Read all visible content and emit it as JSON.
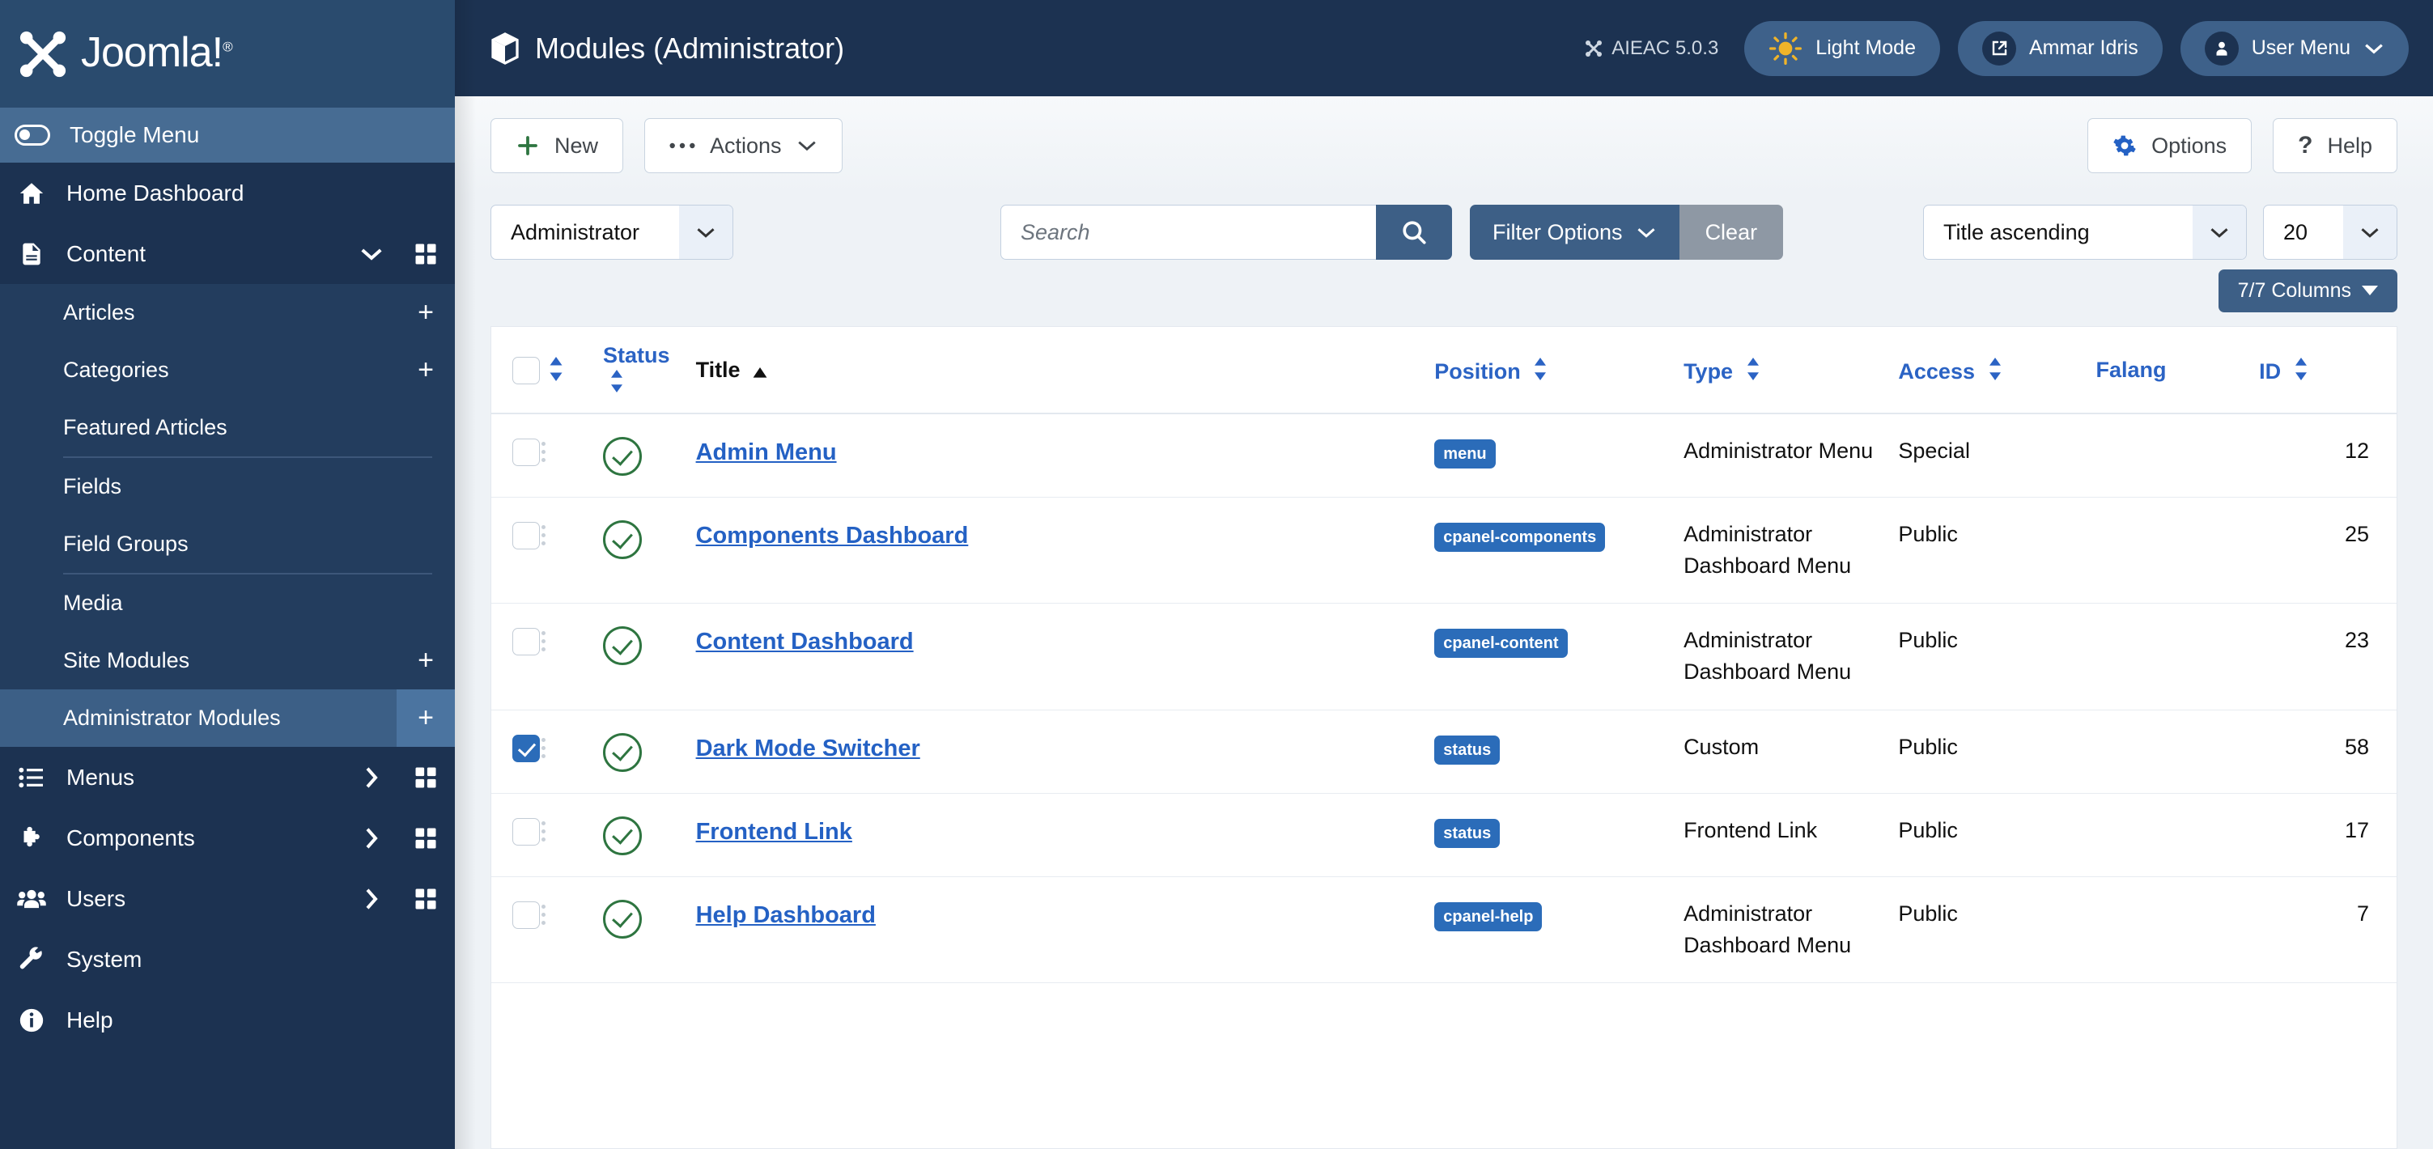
{
  "brand": {
    "name": "Joomla!",
    "trademark": "®"
  },
  "topbar": {
    "page_title": "Modules (Administrator)",
    "version": "AIEAC 5.0.3",
    "light_mode": "Light Mode",
    "site_link": "Ammar Idris",
    "user_menu": "User Menu"
  },
  "sidebar": {
    "toggle": "Toggle Menu",
    "items": [
      {
        "label": "Home Dashboard",
        "icon": "home-icon",
        "caret": "",
        "grid": false
      },
      {
        "label": "Content",
        "icon": "document-icon",
        "caret": "∨",
        "grid": true
      },
      {
        "label": "Menus",
        "icon": "list-icon",
        "caret": "›",
        "grid": true
      },
      {
        "label": "Components",
        "icon": "puzzle-icon",
        "caret": "›",
        "grid": true
      },
      {
        "label": "Users",
        "icon": "users-icon",
        "caret": "›",
        "grid": true
      },
      {
        "label": "System",
        "icon": "wrench-icon",
        "caret": "",
        "grid": false
      },
      {
        "label": "Help",
        "icon": "info-icon",
        "caret": "",
        "grid": false
      }
    ],
    "content_submenu": [
      {
        "label": "Articles",
        "plus": "+"
      },
      {
        "label": "Categories",
        "plus": "+"
      },
      {
        "label": "Featured Articles",
        "plus": ""
      },
      {
        "label": "Fields",
        "plus": ""
      },
      {
        "label": "Field Groups",
        "plus": ""
      },
      {
        "label": "Media",
        "plus": ""
      },
      {
        "label": "Site Modules",
        "plus": "+"
      },
      {
        "label": "Administrator Modules",
        "plus": "+",
        "active": true
      }
    ]
  },
  "toolbar": {
    "new_label": "New",
    "actions_label": "Actions",
    "options_label": "Options",
    "help_label": "Help"
  },
  "filterbar": {
    "client_select": "Administrator",
    "search_placeholder": "Search",
    "search_value": "",
    "filter_options": "Filter Options",
    "clear": "Clear",
    "ordering": "Title ascending",
    "limit": "20",
    "columns_button": "7/7 Columns"
  },
  "table": {
    "headers": {
      "ordering": "",
      "status": "Status",
      "title": "Title",
      "position": "Position",
      "type": "Type",
      "access": "Access",
      "falang": "Falang",
      "id": "ID"
    },
    "active_sort_column": "Title",
    "active_sort_direction": "ascending",
    "rows": [
      {
        "checked": false,
        "status": "published",
        "title": "Admin Menu",
        "position": "menu",
        "type": "Administrator Menu",
        "access": "Special",
        "falang": "",
        "id": "12"
      },
      {
        "checked": false,
        "status": "published",
        "title": "Components Dashboard",
        "position": "cpanel-components",
        "type": "Administrator Dashboard Menu",
        "access": "Public",
        "falang": "",
        "id": "25"
      },
      {
        "checked": false,
        "status": "published",
        "title": "Content Dashboard",
        "position": "cpanel-content",
        "type": "Administrator Dashboard Menu",
        "access": "Public",
        "falang": "",
        "id": "23"
      },
      {
        "checked": true,
        "status": "published",
        "title": "Dark Mode Switcher",
        "position": "status",
        "type": "Custom",
        "access": "Public",
        "falang": "",
        "id": "58"
      },
      {
        "checked": false,
        "status": "published",
        "title": "Frontend Link",
        "position": "status",
        "type": "Frontend Link",
        "access": "Public",
        "falang": "",
        "id": "17"
      },
      {
        "checked": false,
        "status": "published",
        "title": "Help Dashboard",
        "position": "cpanel-help",
        "type": "Administrator Dashboard Menu",
        "access": "Public",
        "falang": "",
        "id": "7"
      }
    ]
  },
  "colors": {
    "sidebar_bg": "#1c3251",
    "sidebar_brand_bg": "#2a4b6e",
    "accent_blue": "#2b6cb9",
    "primary_button": "#3d5f86",
    "status_green": "#2e7540",
    "link_blue": "#2461c4"
  }
}
